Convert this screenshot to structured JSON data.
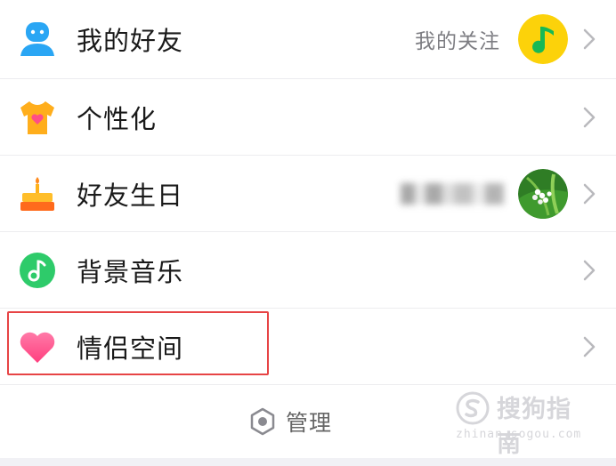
{
  "menu": {
    "items": [
      {
        "label": "我的好友",
        "extra": "我的关注",
        "icon": "person-icon"
      },
      {
        "label": "个性化",
        "icon": "tshirt-heart-icon"
      },
      {
        "label": "好友生日",
        "icon": "birthday-cake-icon",
        "extra_blurred": true
      },
      {
        "label": "背景音乐",
        "icon": "music-note-icon"
      },
      {
        "label": "情侣空间",
        "icon": "heart-icon",
        "highlighted": true
      }
    ]
  },
  "footer": {
    "manage_label": "管理",
    "icon": "hexagon-settings-icon"
  },
  "watermark": {
    "name": "搜狗指南",
    "url": "zhinan.sogou.com"
  },
  "colors": {
    "highlight_border": "#e74445",
    "person_icon": "#27a9f5",
    "qq_music_yellow": "#fcd20a",
    "music_green": "#2ecb6a",
    "heart_pink": "#ff4f8b"
  }
}
